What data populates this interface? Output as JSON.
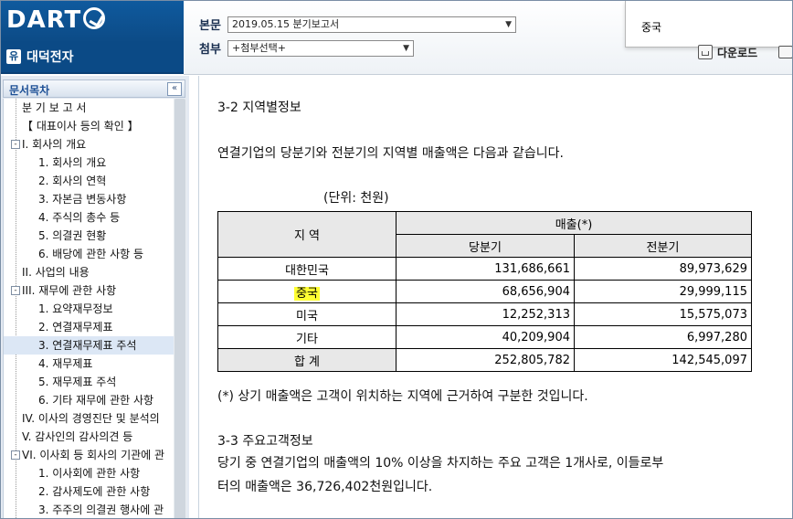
{
  "header": {
    "logo_text": "DART",
    "company_badge": "유",
    "company_name": "대덕전자",
    "main_label": "본문",
    "main_select": "2019.05.15   분기보고서",
    "attach_label": "첨부",
    "attach_select": "+첨부선택+",
    "popup_text": "중국",
    "download_label": "다운로드"
  },
  "sidebar": {
    "title": "문서목차",
    "collapse_symbol": "«",
    "items": [
      {
        "label": "분 기 보 고 서",
        "indent": 1,
        "toggle": ""
      },
      {
        "label": "【 대표이사 등의 확인 】",
        "indent": 1,
        "toggle": ""
      },
      {
        "label": "I. 회사의 개요",
        "indent": 0,
        "toggle": "-"
      },
      {
        "label": "1. 회사의 개요",
        "indent": 2,
        "toggle": ""
      },
      {
        "label": "2. 회사의 연혁",
        "indent": 2,
        "toggle": ""
      },
      {
        "label": "3. 자본금 변동사항",
        "indent": 2,
        "toggle": ""
      },
      {
        "label": "4. 주식의 총수 등",
        "indent": 2,
        "toggle": ""
      },
      {
        "label": "5. 의결권 현황",
        "indent": 2,
        "toggle": ""
      },
      {
        "label": "6. 배당에 관한 사항 등",
        "indent": 2,
        "toggle": ""
      },
      {
        "label": "II. 사업의 내용",
        "indent": 1,
        "toggle": ""
      },
      {
        "label": "III. 재무에 관한 사항",
        "indent": 0,
        "toggle": "-"
      },
      {
        "label": "1. 요약재무정보",
        "indent": 2,
        "toggle": ""
      },
      {
        "label": "2. 연결재무제표",
        "indent": 2,
        "toggle": ""
      },
      {
        "label": "3. 연결재무제표 주석",
        "indent": 2,
        "toggle": "",
        "selected": true
      },
      {
        "label": "4. 재무제표",
        "indent": 2,
        "toggle": ""
      },
      {
        "label": "5. 재무제표 주석",
        "indent": 2,
        "toggle": ""
      },
      {
        "label": "6. 기타 재무에 관한 사항",
        "indent": 2,
        "toggle": ""
      },
      {
        "label": "IV. 이사의 경영진단 및 분석의",
        "indent": 1,
        "toggle": ""
      },
      {
        "label": "V. 감사인의 감사의견 등",
        "indent": 1,
        "toggle": ""
      },
      {
        "label": "VI. 이사회 등 회사의 기관에 관",
        "indent": 0,
        "toggle": "-"
      },
      {
        "label": "1. 이사회에 관한 사항",
        "indent": 2,
        "toggle": ""
      },
      {
        "label": "2. 감사제도에 관한 사항",
        "indent": 2,
        "toggle": ""
      },
      {
        "label": "3. 주주의 의결권 행사에 관",
        "indent": 2,
        "toggle": ""
      }
    ]
  },
  "document": {
    "section_3_2_title": "3-2 지역별정보",
    "intro": "연결기업의 당분기와 전분기의 지역별 매출액은 다음과 같습니다.",
    "unit": "(단위: 천원)",
    "table": {
      "region_header": "지    역",
      "sales_header": "매출(*)",
      "current_header": "당분기",
      "prior_header": "전분기",
      "rows": [
        {
          "region": "대한민국",
          "current": "131,686,661",
          "prior": "89,973,629"
        },
        {
          "region": "중국",
          "current": "68,656,904",
          "prior": "29,999,115",
          "highlight": true
        },
        {
          "region": "미국",
          "current": "12,252,313",
          "prior": "15,575,073"
        },
        {
          "region": "기타",
          "current": "40,209,904",
          "prior": "6,997,280"
        },
        {
          "region": "합    계",
          "current": "252,805,782",
          "prior": "142,545,097",
          "total": true
        }
      ]
    },
    "footnote": "(*) 상기 매출액은 고객이 위치하는 지역에 근거하여 구분한 것입니다.",
    "section_3_3_title": "3-3 주요고객정보",
    "customer_line1": "당기 중 연결기업의 매출액의 10% 이상을 차지하는 주요 고객은 1개사로, 이들로부",
    "customer_line2": "터의 매출액은 36,726,402천원입니다."
  }
}
